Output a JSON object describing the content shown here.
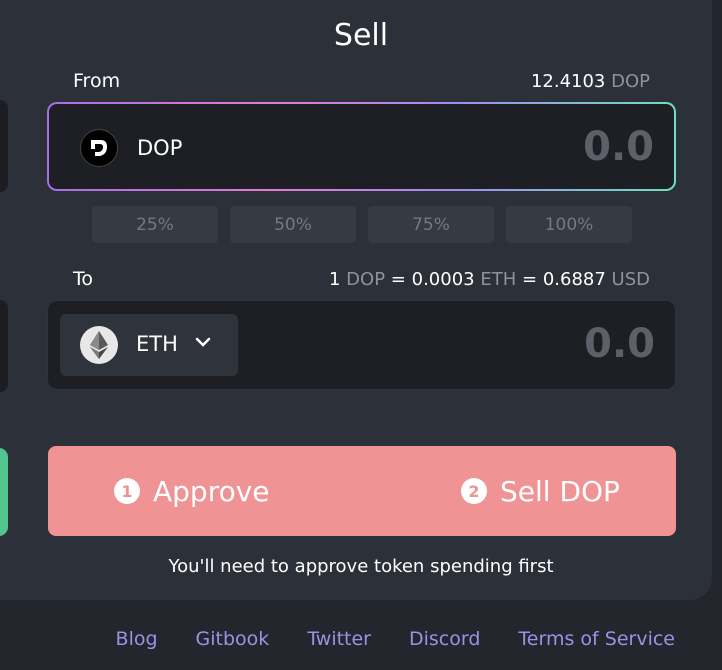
{
  "title": "Sell",
  "from": {
    "label": "From",
    "balance_value": "12.4103",
    "balance_unit": "DOP",
    "token": "DOP",
    "token_icon": "dop-logo-icon",
    "amount": "0.0"
  },
  "percent_buttons": [
    "25%",
    "50%",
    "75%",
    "100%"
  ],
  "to": {
    "label": "To",
    "rate": {
      "lhs_value": "1",
      "lhs_unit": "DOP",
      "eq": "=",
      "mid_value": "0.0003",
      "mid_unit": "ETH",
      "rhs_value": "0.6887",
      "rhs_unit": "USD"
    },
    "token": "ETH",
    "token_icon": "ethereum-logo-icon",
    "amount": "0.0"
  },
  "actions": {
    "approve_num": "1",
    "approve_label": "Approve",
    "sell_num": "2",
    "sell_label": "Sell DOP",
    "hint": "You'll need to approve token spending first"
  },
  "footer": {
    "blog": "Blog",
    "gitbook": "Gitbook",
    "twitter": "Twitter",
    "discord": "Discord",
    "terms": "Terms of Service"
  },
  "colors": {
    "button": "#f09395",
    "accent_link": "#9a92e6",
    "panel": "#2c3038",
    "input_bg": "#1d1f24"
  }
}
